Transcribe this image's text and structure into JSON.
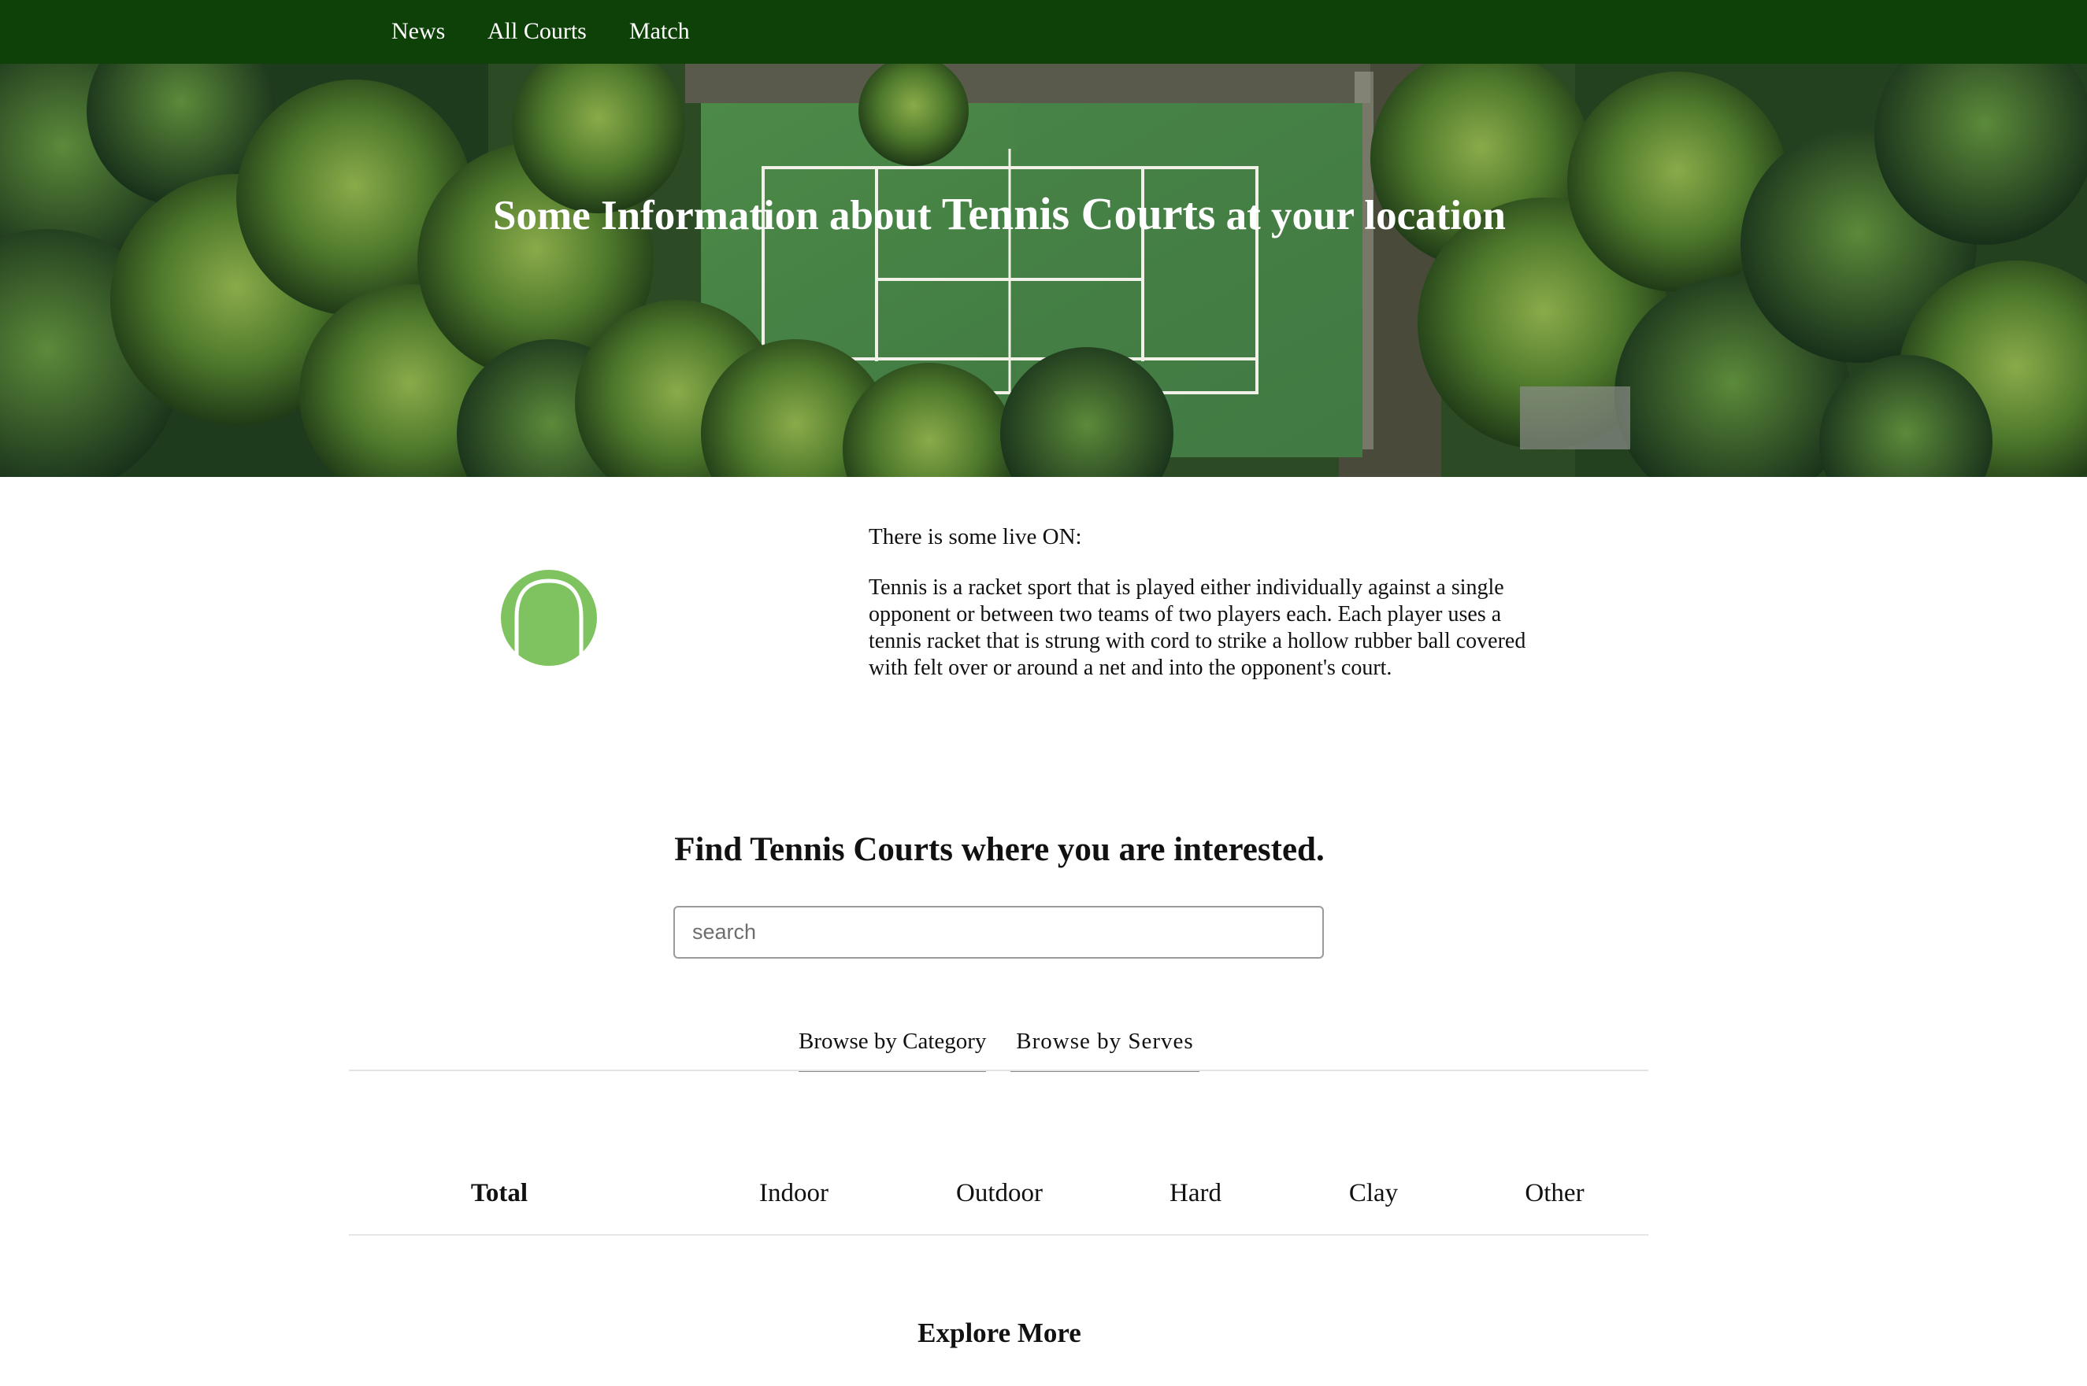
{
  "nav": {
    "items": [
      {
        "label": "News"
      },
      {
        "label": "All Courts"
      },
      {
        "label": "Match"
      }
    ]
  },
  "hero": {
    "title_prefix": "Some Information about ",
    "title_emphasis": "Tennis Courts",
    "title_suffix": " at your location"
  },
  "info": {
    "live": "There is some live ON:",
    "description": "Tennis is a racket sport that is played either individually against a single opponent or between two teams of two players each. Each player uses a tennis racket that is strung with cord to strike a hollow rubber ball covered with felt over or around a net and into the opponent's court.",
    "icon": "tennis-ball-icon",
    "icon_color": "#7ec35f"
  },
  "find": {
    "heading": "Find Tennis Courts where you are interested.",
    "search_placeholder": "search"
  },
  "tabs": [
    {
      "label": "Browse by Category"
    },
    {
      "label": "Browse by Serves"
    }
  ],
  "categories": [
    {
      "label": "Total"
    },
    {
      "label": "Indoor"
    },
    {
      "label": "Outdoor"
    },
    {
      "label": "Hard"
    },
    {
      "label": "Clay"
    },
    {
      "label": "Other"
    }
  ],
  "explore": "Explore More",
  "colors": {
    "nav_bg": "#0e4107",
    "court_green": "#4d8a48"
  }
}
